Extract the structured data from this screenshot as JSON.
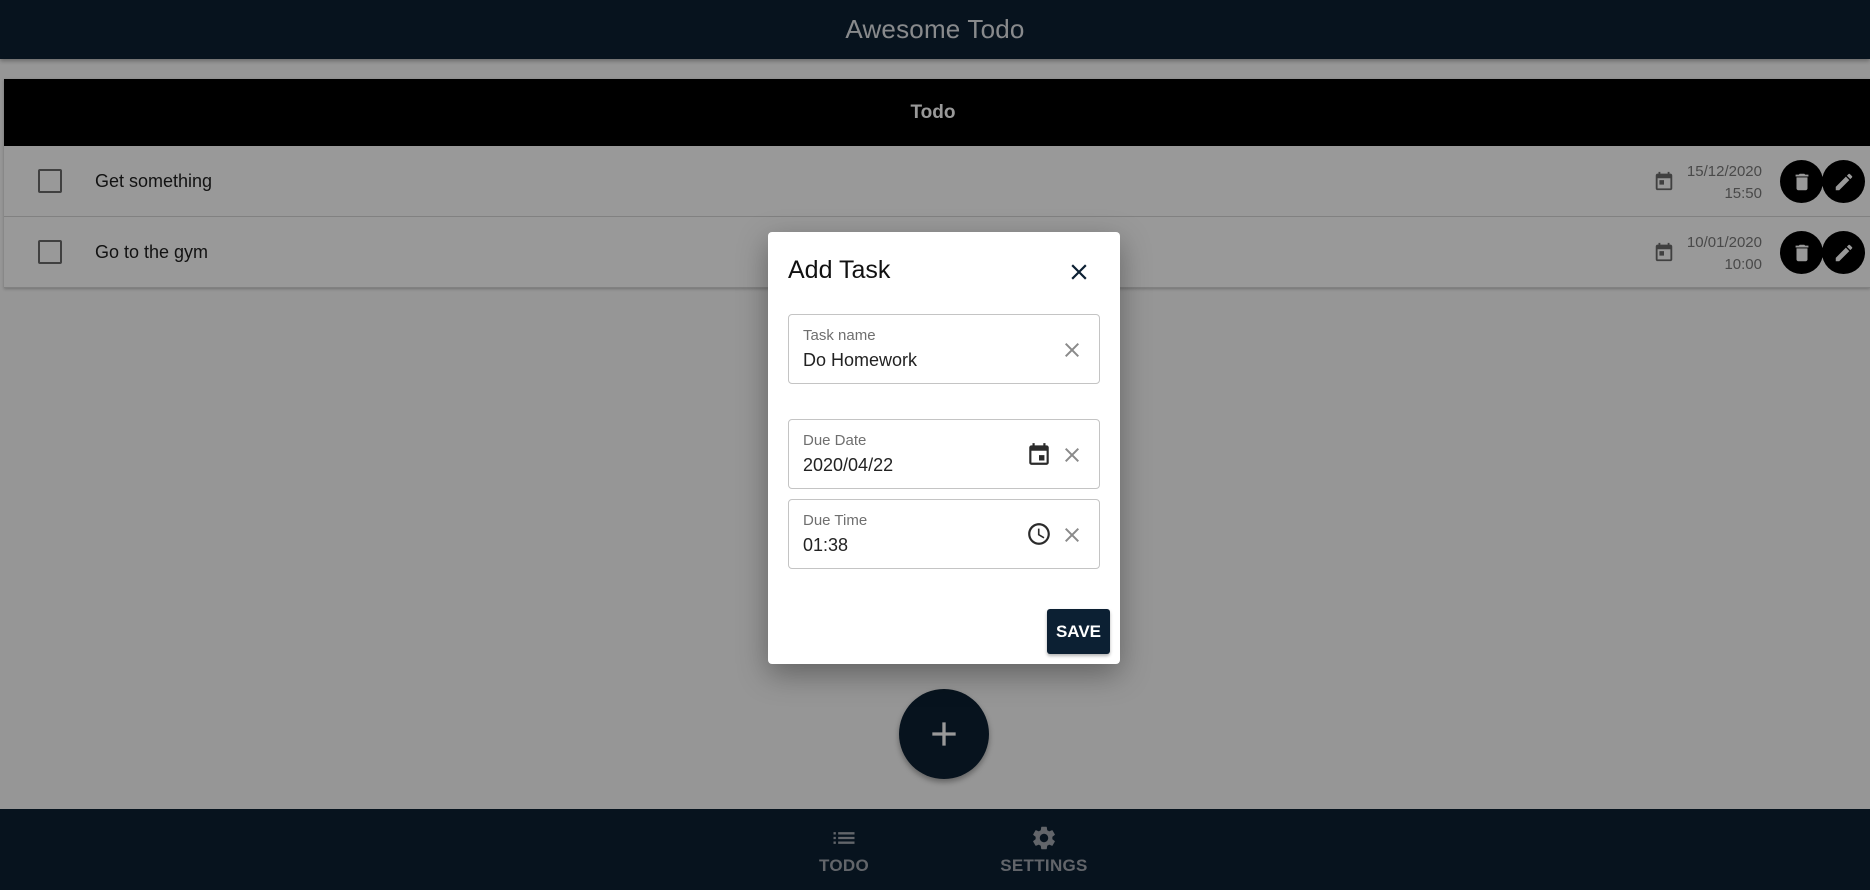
{
  "app": {
    "title": "Awesome Todo"
  },
  "todo": {
    "header": "Todo",
    "items": [
      {
        "label": "Get something",
        "date": "15/12/2020",
        "time": "15:50",
        "done": false
      },
      {
        "label": "Go to the gym",
        "date": "10/01/2020",
        "time": "10:00",
        "done": false
      }
    ]
  },
  "dialog": {
    "title": "Add Task",
    "fields": {
      "task_name": {
        "label": "Task name",
        "value": "Do Homework"
      },
      "due_date": {
        "label": "Due Date",
        "value": "2020/04/22"
      },
      "due_time": {
        "label": "Due Time",
        "value": "01:38"
      }
    },
    "save_label": "SAVE"
  },
  "nav": {
    "items": [
      {
        "label": "TODO",
        "icon": "list-icon"
      },
      {
        "label": "SETTINGS",
        "icon": "gear-icon"
      }
    ]
  },
  "colors": {
    "primary": "#0c2033",
    "header": "#000000",
    "overlay": "rgba(0,0,0,0.40)"
  },
  "icons": {
    "fab": "plus-icon",
    "row_date": "calendar-icon",
    "row_delete": "trash-icon",
    "row_edit": "pencil-icon",
    "dialog_close": "close-icon",
    "field_clear": "clear-icon",
    "date_picker": "calendar-icon",
    "time_picker": "clock-icon"
  }
}
